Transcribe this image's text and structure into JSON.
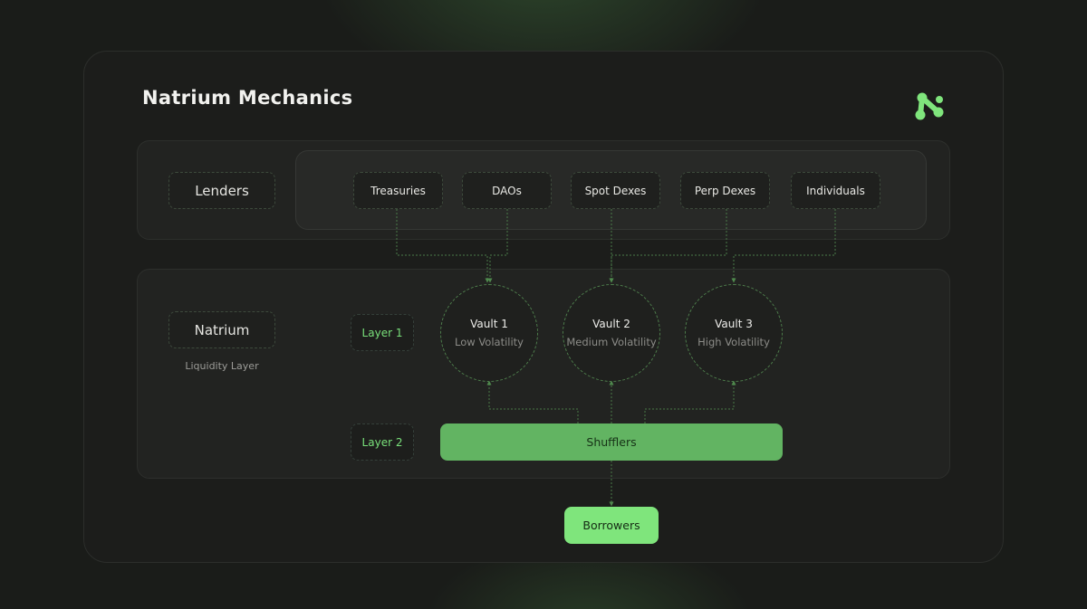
{
  "title": "Natrium Mechanics",
  "logo_icon": "natrium-logo-icon",
  "lenders": {
    "label": "Lenders",
    "sources": [
      "Treasuries",
      "DAOs",
      "Spot Dexes",
      "Perp Dexes",
      "Individuals"
    ]
  },
  "natrium": {
    "label": "Natrium",
    "caption": "Liquidity Layer"
  },
  "layers": {
    "layer1": "Layer 1",
    "layer2": "Layer 2"
  },
  "vaults": [
    {
      "name": "Vault 1",
      "volatility": "Low Volatility"
    },
    {
      "name": "Vault 2",
      "volatility": "Medium Volatility"
    },
    {
      "name": "Vault 3",
      "volatility": "High Volatility"
    }
  ],
  "shufflers": "Shufflers",
  "borrowers": "Borrowers",
  "colors": {
    "accent": "#79e07a",
    "shufflers_fill": "#62b462",
    "borrowers_fill": "#7fe57c",
    "background": "#1a1c19"
  }
}
